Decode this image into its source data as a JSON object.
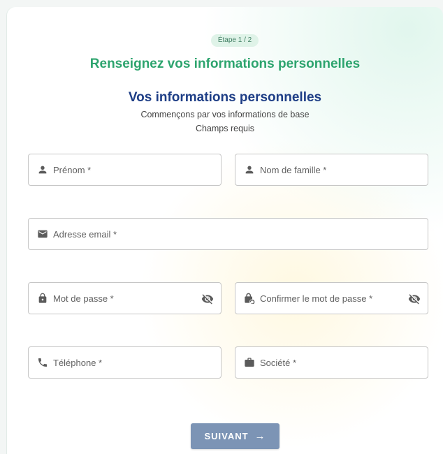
{
  "step_badge": "Étape 1 / 2",
  "heading": "Renseignez vos informations personnelles",
  "section_title": "Vos informations personnelles",
  "description": "Commençons par vos informations de base",
  "required_note": "Champs requis",
  "fields": {
    "first_name": {
      "label": "Prénom *",
      "icon": "person-icon"
    },
    "last_name": {
      "label": "Nom de famille *",
      "icon": "person-icon"
    },
    "email": {
      "label": "Adresse email *",
      "icon": "mail-icon"
    },
    "password": {
      "label": "Mot de passe *",
      "icon": "lock-icon",
      "toggle_icon": "eye-off-icon"
    },
    "confirm_password": {
      "label": "Confirmer le mot de passe *",
      "icon": "lock-reset-icon",
      "toggle_icon": "eye-off-icon"
    },
    "phone": {
      "label": "Téléphone *",
      "icon": "phone-icon"
    },
    "company": {
      "label": "Société *",
      "icon": "briefcase-icon"
    }
  },
  "next_button": {
    "label": "SUIVANT",
    "icon": "arrow-right-icon"
  },
  "colors": {
    "heading_green": "#2da46e",
    "section_blue": "#1e3e86",
    "button_blue": "#7c94b5",
    "badge_bg": "#dff3e8"
  }
}
